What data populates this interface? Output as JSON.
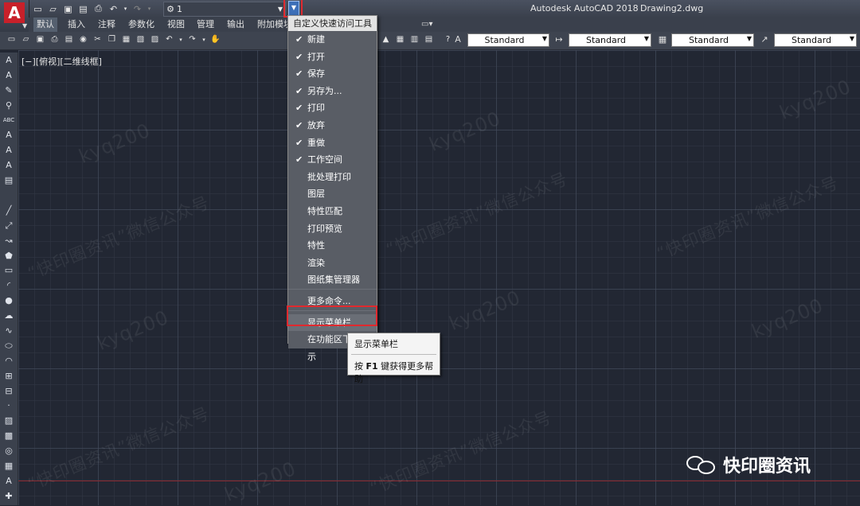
{
  "app": {
    "logo_letter": "A",
    "title": "Autodesk AutoCAD 2018",
    "document": "Drawing2.dwg"
  },
  "qat": {
    "workspace_value": "1"
  },
  "ribbon_tabs": [
    "默认",
    "插入",
    "注释",
    "参数化",
    "视图",
    "管理",
    "输出",
    "附加模块"
  ],
  "toolbar": {
    "styles": [
      "Standard",
      "Standard",
      "Standard",
      "Standard"
    ]
  },
  "viewport_label": "[−][俯视][二维线框]",
  "menu": {
    "title": "自定义快速访问工具栏",
    "items": [
      {
        "label": "新建",
        "checked": true
      },
      {
        "label": "打开",
        "checked": true
      },
      {
        "label": "保存",
        "checked": true
      },
      {
        "label": "另存为...",
        "checked": true
      },
      {
        "label": "打印",
        "checked": true
      },
      {
        "label": "放弃",
        "checked": true
      },
      {
        "label": "重做",
        "checked": true
      },
      {
        "label": "工作空间",
        "checked": true
      },
      {
        "label": "批处理打印",
        "checked": false
      },
      {
        "label": "图层",
        "checked": false
      },
      {
        "label": "特性匹配",
        "checked": false
      },
      {
        "label": "打印预览",
        "checked": false
      },
      {
        "label": "特性",
        "checked": false
      },
      {
        "label": "渲染",
        "checked": false
      },
      {
        "label": "图纸集管理器",
        "checked": false
      }
    ],
    "more": "更多命令...",
    "show_menubar": "显示菜单栏",
    "below_ribbon": "在功能区下方显示"
  },
  "tooltip": {
    "title": "显示菜单栏",
    "help_prefix": "按",
    "help_key": "F1",
    "help_suffix": "键获得更多帮助"
  },
  "watermarks": {
    "handle": "kyq200",
    "wechat": "“快印圈资讯”微信公众号"
  },
  "brand": {
    "name": "快印圈资讯"
  },
  "colors": {
    "highlight": "#e0292e",
    "logo": "#c8202a"
  }
}
